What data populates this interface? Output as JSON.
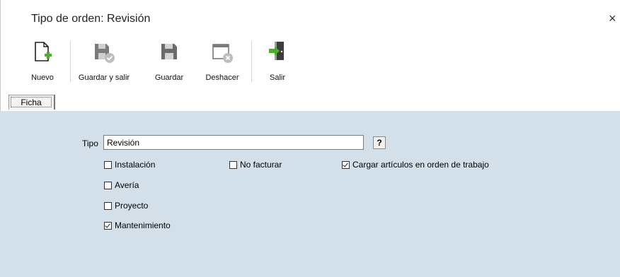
{
  "window": {
    "title": "Tipo de orden: Revisión",
    "close_glyph": "×"
  },
  "toolbar": {
    "buttons": [
      {
        "label": "Nuevo",
        "icon": "new-document-icon"
      },
      {
        "label": "Guardar y salir",
        "icon": "save-and-exit-icon"
      },
      {
        "label": "Guardar",
        "icon": "save-icon"
      },
      {
        "label": "Deshacer",
        "icon": "undo-icon"
      },
      {
        "label": "Salir",
        "icon": "exit-icon"
      }
    ]
  },
  "tabs": [
    {
      "label": "Ficha",
      "active": true
    }
  ],
  "form": {
    "tipo_label": "Tipo",
    "tipo_value": "Revisión",
    "help_label": "?",
    "checkboxes": [
      {
        "label": "Instalación",
        "checked": false
      },
      {
        "label": "Avería",
        "checked": false
      },
      {
        "label": "Proyecto",
        "checked": false
      },
      {
        "label": "Mantenimiento",
        "checked": true
      },
      {
        "label": "No facturar",
        "checked": false
      },
      {
        "label": "Cargar artículos en orden de trabajo",
        "checked": true
      }
    ]
  },
  "colors": {
    "panel_bg": "#d3e0ea",
    "icon_gray": "#6b6b6b",
    "icon_green": "#4caf27",
    "door_dark": "#3c3c3c"
  }
}
